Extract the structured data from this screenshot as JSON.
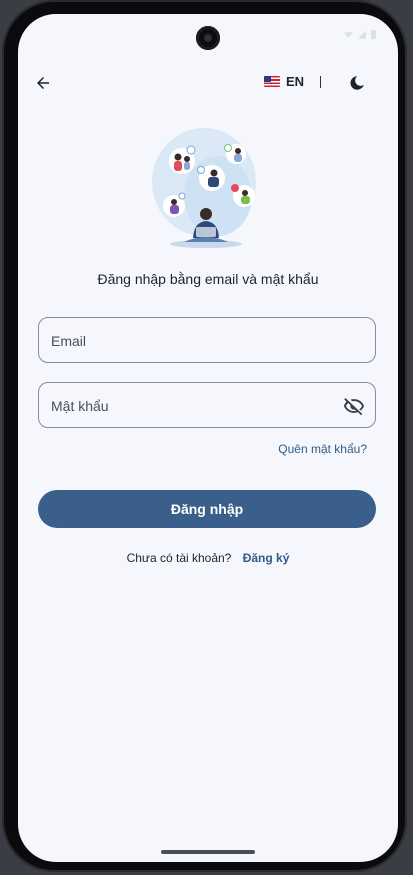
{
  "header": {
    "language_code": "EN",
    "language_flag": "us-flag-icon",
    "back_icon": "arrow-left-icon",
    "theme_icon": "moon-icon"
  },
  "illustration": "people-network-illustration",
  "login": {
    "subtitle": "Đăng nhập bằng email và mật khẩu",
    "email_placeholder": "Email",
    "password_placeholder": "Mật khẩu",
    "password_toggle_icon": "eye-off-icon",
    "forgot_password": "Quên mật khẩu?",
    "submit_label": "Đăng nhập",
    "no_account_text": "Chưa có tài khoản?",
    "signup_link": "Đăng ký"
  },
  "colors": {
    "primary": "#3a5f8a",
    "link": "#2f5b88",
    "background": "#f6f7fc",
    "text": "#1e2230"
  }
}
